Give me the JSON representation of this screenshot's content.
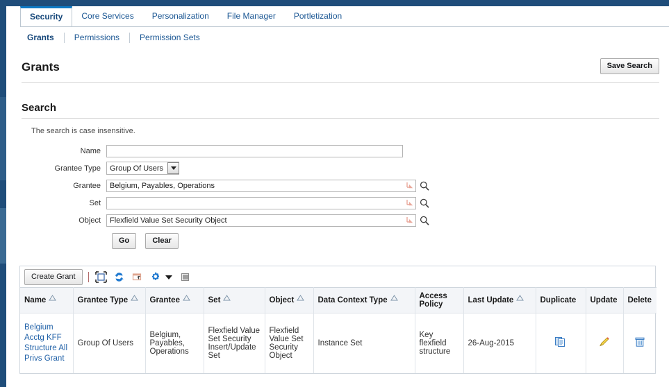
{
  "colors": {
    "navy": "#1f4d7a",
    "tab_accent": "#0e7ac4",
    "link": "#1a5693",
    "cell_link": "#2262a8"
  },
  "tabs": [
    {
      "label": "Security",
      "active": true
    },
    {
      "label": "Core Services",
      "active": false
    },
    {
      "label": "Personalization",
      "active": false
    },
    {
      "label": "File Manager",
      "active": false
    },
    {
      "label": "Portletization",
      "active": false
    }
  ],
  "subtabs": [
    {
      "label": "Grants",
      "active": true
    },
    {
      "label": "Permissions",
      "active": false
    },
    {
      "label": "Permission Sets",
      "active": false
    }
  ],
  "header": {
    "title": "Grants",
    "save_search_label": "Save Search"
  },
  "search": {
    "heading": "Search",
    "hint": "The search is case insensitive.",
    "fields": {
      "name": {
        "label": "Name",
        "value": "",
        "placeholder": ""
      },
      "grantee_type": {
        "label": "Grantee Type",
        "value": "Group Of Users",
        "options": [
          "Group Of Users"
        ]
      },
      "grantee": {
        "label": "Grantee",
        "value": "Belgium, Payables, Operations",
        "placeholder": ""
      },
      "set": {
        "label": "Set",
        "value": "",
        "placeholder": ""
      },
      "object": {
        "label": "Object",
        "value": "Flexfield Value Set Security Object",
        "placeholder": ""
      }
    },
    "buttons": {
      "go": "Go",
      "clear": "Clear"
    }
  },
  "results": {
    "toolbar": {
      "create_grant_label": "Create Grant",
      "icons": [
        "detach-icon",
        "refresh-icon",
        "export-icon",
        "gear-icon",
        "chevron-down-icon",
        "columns-icon"
      ]
    },
    "columns": [
      {
        "label": "Name",
        "sortable": true
      },
      {
        "label": "Grantee Type",
        "sortable": true
      },
      {
        "label": "Grantee",
        "sortable": true
      },
      {
        "label": "Set",
        "sortable": true
      },
      {
        "label": "Object",
        "sortable": true
      },
      {
        "label": "Data Context Type",
        "sortable": true
      },
      {
        "label": "Access Policy",
        "sortable": false
      },
      {
        "label": "Last Update",
        "sortable": true
      },
      {
        "label": "Duplicate",
        "sortable": false
      },
      {
        "label": "Update",
        "sortable": false
      },
      {
        "label": "Delete",
        "sortable": false
      }
    ],
    "rows": [
      {
        "name": "Belgium Acctg KFF Structure All Privs Grant",
        "grantee_type": "Group Of Users",
        "grantee": "Belgium, Payables, Operations",
        "set": "Flexfield Value Set Security Insert/Update Set",
        "object": "Flexfield Value Set Security Object",
        "data_context_type": "Instance Set",
        "access_policy": "Key flexfield structure",
        "last_update": "26-Aug-2015",
        "duplicate_icon": "duplicate-icon",
        "update_icon": "pencil-icon",
        "delete_icon": "trash-icon"
      }
    ]
  }
}
